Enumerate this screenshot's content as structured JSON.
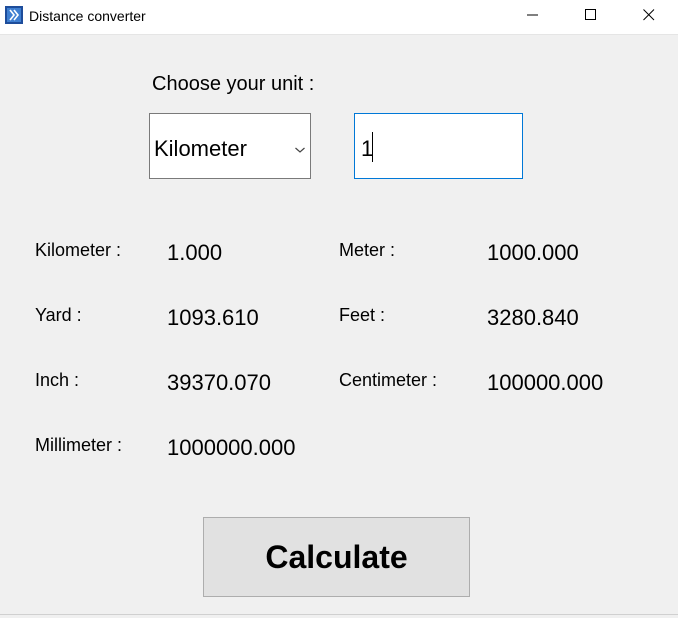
{
  "window": {
    "title": "Distance converter"
  },
  "form": {
    "choose_label": "Choose your unit :",
    "selected_unit": "Kilometer",
    "input_value": "1"
  },
  "results": {
    "kilometer": {
      "label": "Kilometer :",
      "value": "1.000"
    },
    "meter": {
      "label": "Meter :",
      "value": "1000.000"
    },
    "yard": {
      "label": "Yard :",
      "value": "1093.610"
    },
    "feet": {
      "label": "Feet :",
      "value": "3280.840"
    },
    "inch": {
      "label": "Inch :",
      "value": "39370.070"
    },
    "centimeter": {
      "label": "Centimeter :",
      "value": "100000.000"
    },
    "millimeter": {
      "label": "Millimeter :",
      "value": "1000000.000"
    }
  },
  "actions": {
    "calculate_label": "Calculate"
  },
  "colors": {
    "input_focus_border": "#0078d7",
    "window_background": "#f0f0f0",
    "button_background": "#e1e1e1"
  }
}
